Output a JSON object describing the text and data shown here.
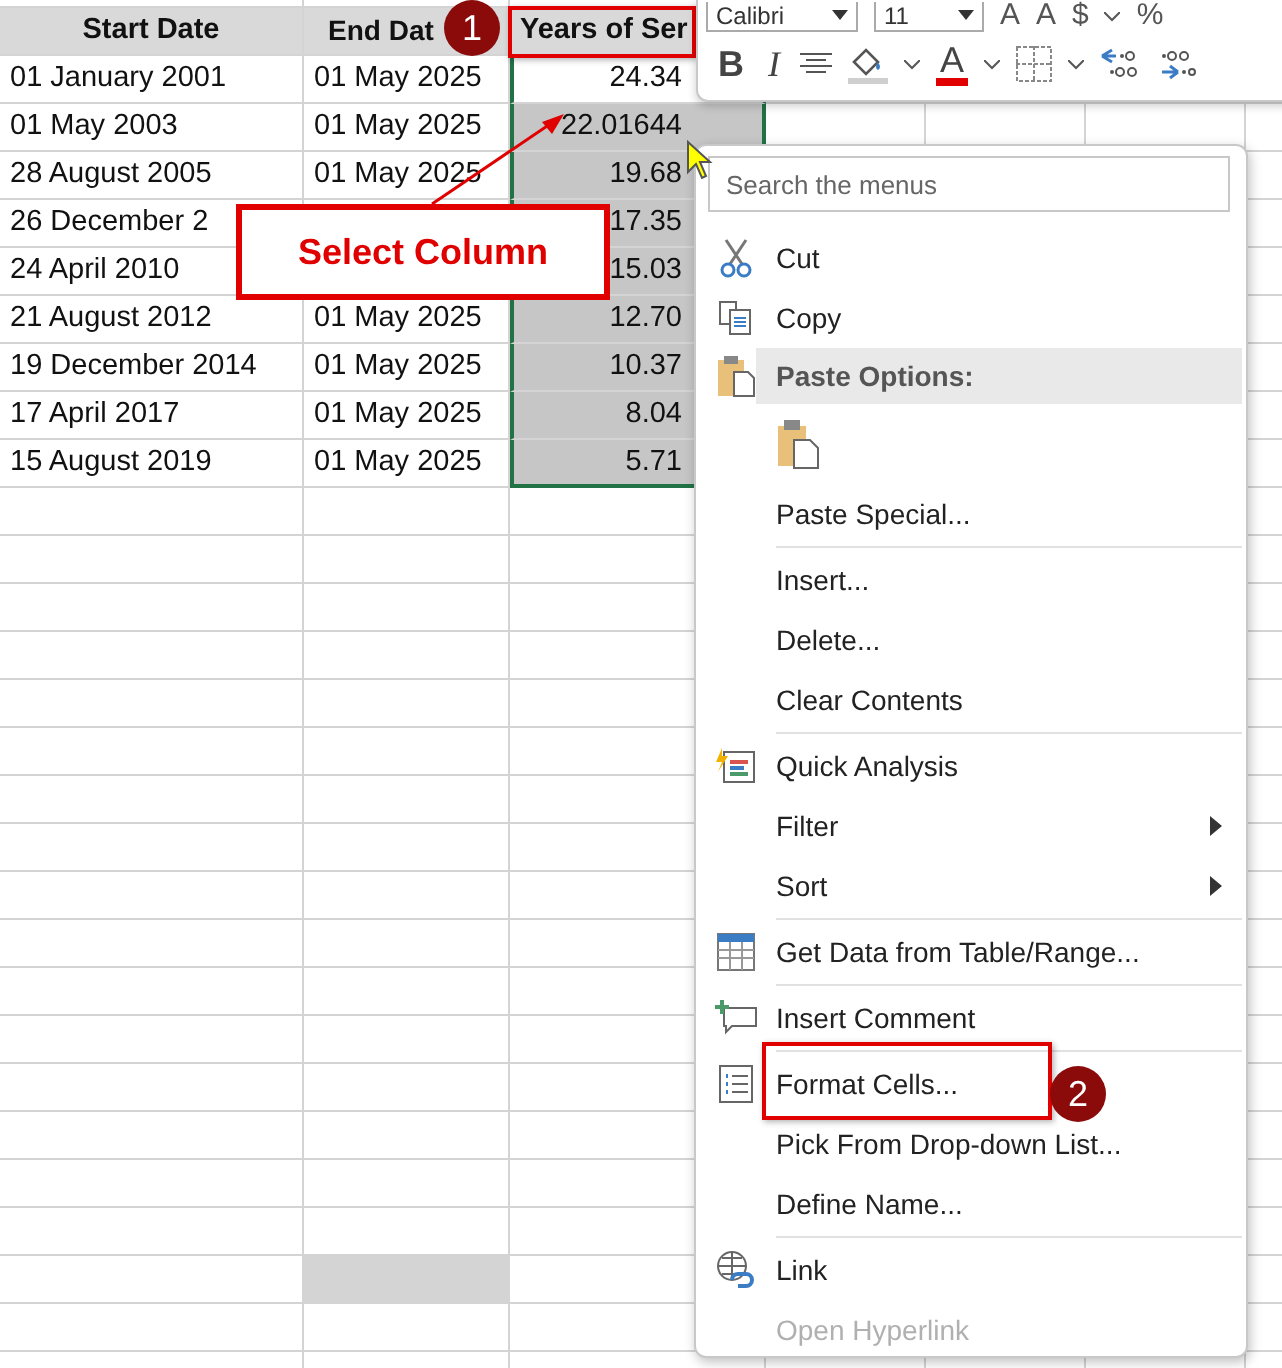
{
  "sheet": {
    "columns": [
      "Start Date",
      "End Dat",
      "Years of Ser"
    ],
    "rows": [
      {
        "start": "01 January 2001",
        "end": "01 May 2025",
        "years": "24.34",
        "selected": true,
        "active": true
      },
      {
        "start": "01 May 2003",
        "end": "01 May 2025",
        "years": "22.01644",
        "selected": true,
        "active": false
      },
      {
        "start": "28 August 2005",
        "end": "01 May 2025",
        "years": "19.68",
        "selected": true,
        "active": false
      },
      {
        "start": "26 December 2",
        "years": "17.35",
        "selected": true,
        "active": false
      },
      {
        "start": "24 April 2010",
        "years": "15.03",
        "selected": true,
        "active": false
      },
      {
        "start": "21 August 2012",
        "end": "01 May 2025",
        "years": "12.70",
        "selected": true,
        "active": false
      },
      {
        "start": "19 December 2014",
        "end": "01 May 2025",
        "years": "10.37",
        "selected": true,
        "active": false
      },
      {
        "start": "17 April 2017",
        "end": "01 May 2025",
        "years": "8.04",
        "selected": true,
        "active": false
      },
      {
        "start": "15 August 2019",
        "end": "01 May 2025",
        "years": "5.71",
        "selected": true,
        "active": false
      }
    ]
  },
  "mini_toolbar": {
    "font": "Calibri",
    "size": "11",
    "grow_font": "A",
    "shrink_font": "A",
    "currency": "$",
    "percent": "%",
    "bold": "B",
    "italic": "I",
    "font_color": "A"
  },
  "context_menu": {
    "search": {
      "placeholder": "Search the menus"
    },
    "items": [
      {
        "label": "Cut",
        "kind": "item"
      },
      {
        "label": "Copy",
        "kind": "item"
      },
      {
        "label": "Paste Options:",
        "kind": "header"
      },
      {
        "kind": "paste-buttons"
      },
      {
        "label": "Paste Special...",
        "kind": "item"
      },
      {
        "kind": "separator"
      },
      {
        "label": "Insert...",
        "kind": "item"
      },
      {
        "label": "Delete...",
        "kind": "item"
      },
      {
        "label": "Clear Contents",
        "kind": "item"
      },
      {
        "kind": "separator"
      },
      {
        "label": "Quick Analysis",
        "kind": "item"
      },
      {
        "label": "Filter",
        "kind": "submenu"
      },
      {
        "label": "Sort",
        "kind": "submenu"
      },
      {
        "kind": "separator"
      },
      {
        "label": "Get Data from Table/Range...",
        "kind": "item"
      },
      {
        "kind": "separator"
      },
      {
        "label": "Insert Comment",
        "kind": "item"
      },
      {
        "kind": "separator"
      },
      {
        "label": "Format Cells...",
        "kind": "item"
      },
      {
        "label": "Pick From Drop-down List...",
        "kind": "item"
      },
      {
        "label": "Define Name...",
        "kind": "item"
      },
      {
        "kind": "separator"
      },
      {
        "label": "Link",
        "kind": "item"
      },
      {
        "label": "Open Hyperlink",
        "kind": "disabled"
      }
    ]
  },
  "annotations": {
    "step_1": "1",
    "step_2": "2",
    "callout": "Select Column"
  }
}
